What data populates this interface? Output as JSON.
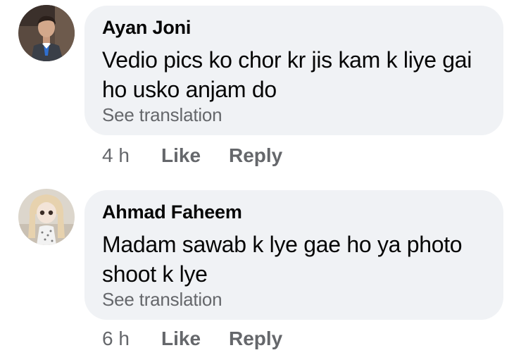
{
  "comments": [
    {
      "author": "Ayan Joni",
      "text": "Vedio pics ko chor kr jis kam k liye gai ho usko anjam do",
      "see_translation": "See translation",
      "time": "4 h",
      "like_label": "Like",
      "reply_label": "Reply",
      "avatar_icon": "profile-photo-man-suit"
    },
    {
      "author": "Ahmad Faheem",
      "text": "Madam sawab k lye gae ho ya photo shoot k lye",
      "see_translation": "See translation",
      "time": "6 h",
      "like_label": "Like",
      "reply_label": "Reply",
      "avatar_icon": "profile-photo-doll"
    }
  ],
  "colors": {
    "bubble": "#f0f2f5",
    "secondary_text": "#65676b",
    "primary_text": "#050505"
  }
}
